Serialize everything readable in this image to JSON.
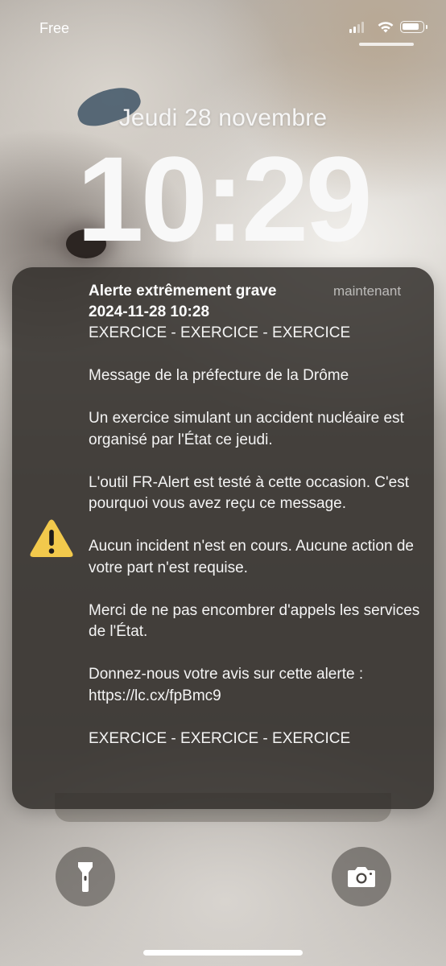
{
  "status_bar": {
    "carrier": "Free",
    "signal_bars": 4,
    "signal_bars_active": 2,
    "wifi_icon": "wifi-icon",
    "battery_icon": "battery-icon",
    "battery_level": 0.8
  },
  "lock_screen": {
    "date": "Jeudi 28 novembre",
    "time": "10:29"
  },
  "alert": {
    "icon": "warning-triangle-icon",
    "icon_color": "#F2C94C",
    "title": "Alerte extrêmement grave",
    "time_ago": "maintenant",
    "datetime": "2024-11-28 10:28",
    "paragraphs": [
      "EXERCICE - EXERCICE - EXERCICE",
      "Message de la préfecture de la Drôme",
      "Un exercice simulant un accident nucléaire est organisé par l'État ce jeudi.",
      "L'outil FR-Alert est testé à cette occasion. C'est pourquoi vous avez reçu ce message.",
      "Aucun incident n'est en cours. Aucune action de votre part n'est requise.",
      "Merci de ne pas encombrer d'appels les services de l'État.",
      "Donnez-nous votre avis sur cette alerte : https://lc.cx/fpBmc9",
      "EXERCICE - EXERCICE - EXERCICE"
    ]
  },
  "controls": {
    "flashlight_icon": "flashlight-icon",
    "camera_icon": "camera-icon"
  }
}
